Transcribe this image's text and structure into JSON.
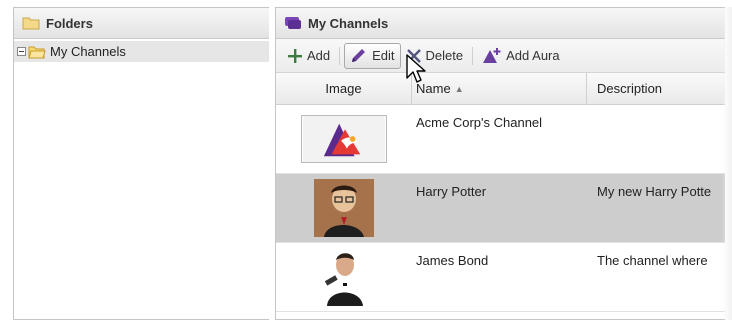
{
  "folders": {
    "title": "Folders",
    "tree": [
      {
        "label": "My Channels",
        "expanded": true,
        "selected": true
      }
    ]
  },
  "channels": {
    "title": "My Channels",
    "toolbar": {
      "add_label": "Add",
      "edit_label": "Edit",
      "delete_label": "Delete",
      "add_aura_label": "Add Aura"
    },
    "columns": {
      "image": "Image",
      "name": "Name",
      "description": "Description"
    },
    "sort": {
      "column": "Name",
      "direction": "ascending"
    },
    "rows": [
      {
        "name": "Acme Corp's Channel",
        "description": "",
        "thumbnail": "acme-logo",
        "selected": false
      },
      {
        "name": "Harry Potter",
        "description": "My new Harry Potte",
        "thumbnail": "harry-potter-photo",
        "selected": true
      },
      {
        "name": "James Bond",
        "description": "The channel where",
        "thumbnail": "james-bond-photo",
        "selected": false
      }
    ]
  },
  "colors": {
    "add_icon": "#3a7d3c",
    "edit_icon": "#6a3fa0",
    "delete_icon": "#5a5a8a",
    "aura_icon": "#6a3fa0",
    "folder_icon": "#f2c94c",
    "selected_row": "#cdcdcd"
  }
}
